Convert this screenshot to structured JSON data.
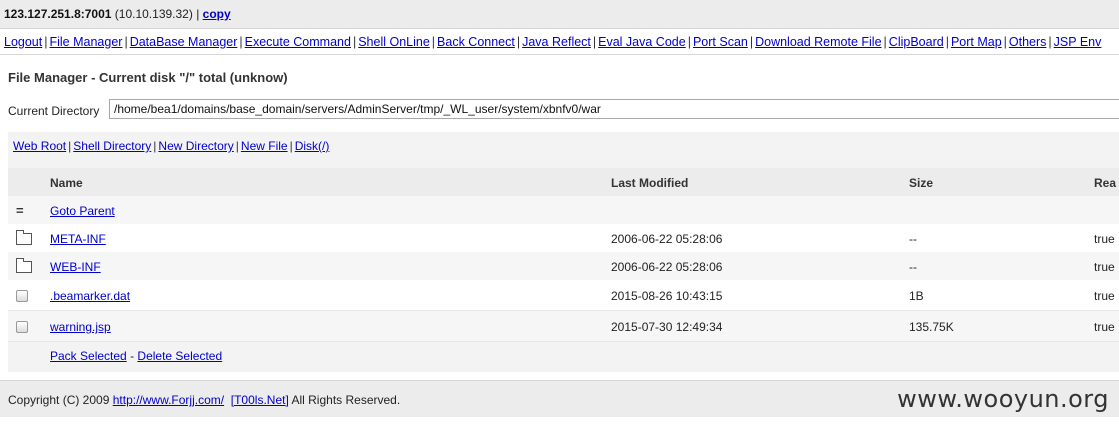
{
  "host": {
    "address": "123.127.251.8:7001",
    "local": "(10.10.139.32)",
    "divider": "|",
    "copy_label": "copy"
  },
  "menu": [
    "Logout",
    "File Manager",
    "DataBase Manager",
    "Execute Command",
    "Shell OnLine",
    "Back Connect",
    "Java Reflect",
    "Eval Java Code",
    "Port Scan",
    "Download Remote File",
    "ClipBoard",
    "Port Map",
    "Others",
    "JSP Env"
  ],
  "page": {
    "title": "File Manager - Current disk \"/\" total (unknow)",
    "dir_label": "Current Directory",
    "dir_value": "/home/bea1/domains/base_domain/servers/AdminServer/tmp/_WL_user/system/xbnfv0/war"
  },
  "quick_links": [
    "Web Root",
    "Shell Directory",
    "New Directory",
    "New File",
    "Disk(/)"
  ],
  "table": {
    "headers": {
      "name": "Name",
      "modified": "Last Modified",
      "size": "Size",
      "read": "Rea"
    },
    "parent": {
      "icon": "=",
      "label": "Goto Parent"
    },
    "rows": [
      {
        "icon": "folder-icon",
        "name": "META-INF",
        "modified": "2006-06-22 05:28:06",
        "size": "--",
        "read": "true ."
      },
      {
        "icon": "folder-icon",
        "name": "WEB-INF",
        "modified": "2006-06-22 05:28:06",
        "size": "--",
        "read": "true ."
      },
      {
        "icon": "checkbox-icon",
        "name": ".beamarker.dat",
        "modified": "2015-08-26 10:43:15",
        "size": "1B",
        "read": "true ."
      },
      {
        "icon": "checkbox-icon",
        "name": "warning.jsp",
        "modified": "2015-07-30 12:49:34",
        "size": "135.75K",
        "read": "true ."
      }
    ]
  },
  "actions": {
    "pack": "Pack Selected",
    "delete": "Delete Selected",
    "divider": "-"
  },
  "footer": {
    "prefix": "Copyright (C) 2009",
    "link1": "http://www.Forjj.com/",
    "link2": "[T00ls.Net]",
    "suffix": "All Rights Reserved.",
    "watermark": "www.wooyun.org"
  }
}
